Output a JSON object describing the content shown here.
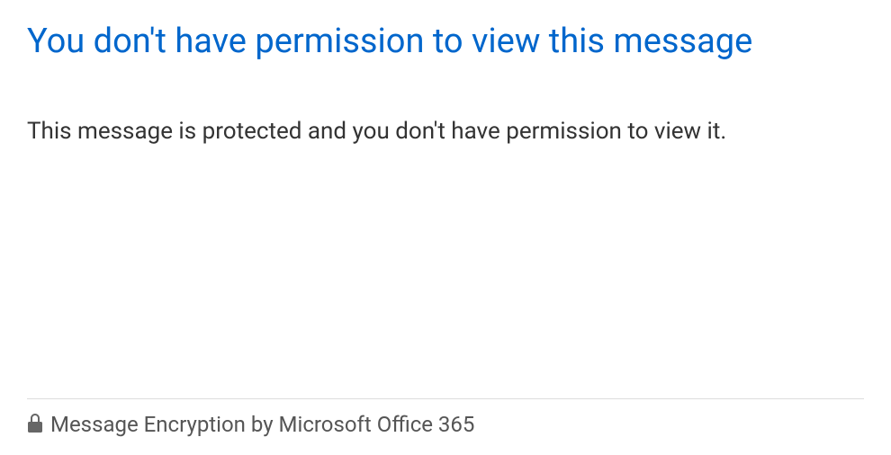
{
  "heading": "You don't have permission to view this message",
  "body": "This message is protected and you don't have permission to view it.",
  "footer": {
    "label": "Message Encryption by Microsoft Office 365"
  }
}
